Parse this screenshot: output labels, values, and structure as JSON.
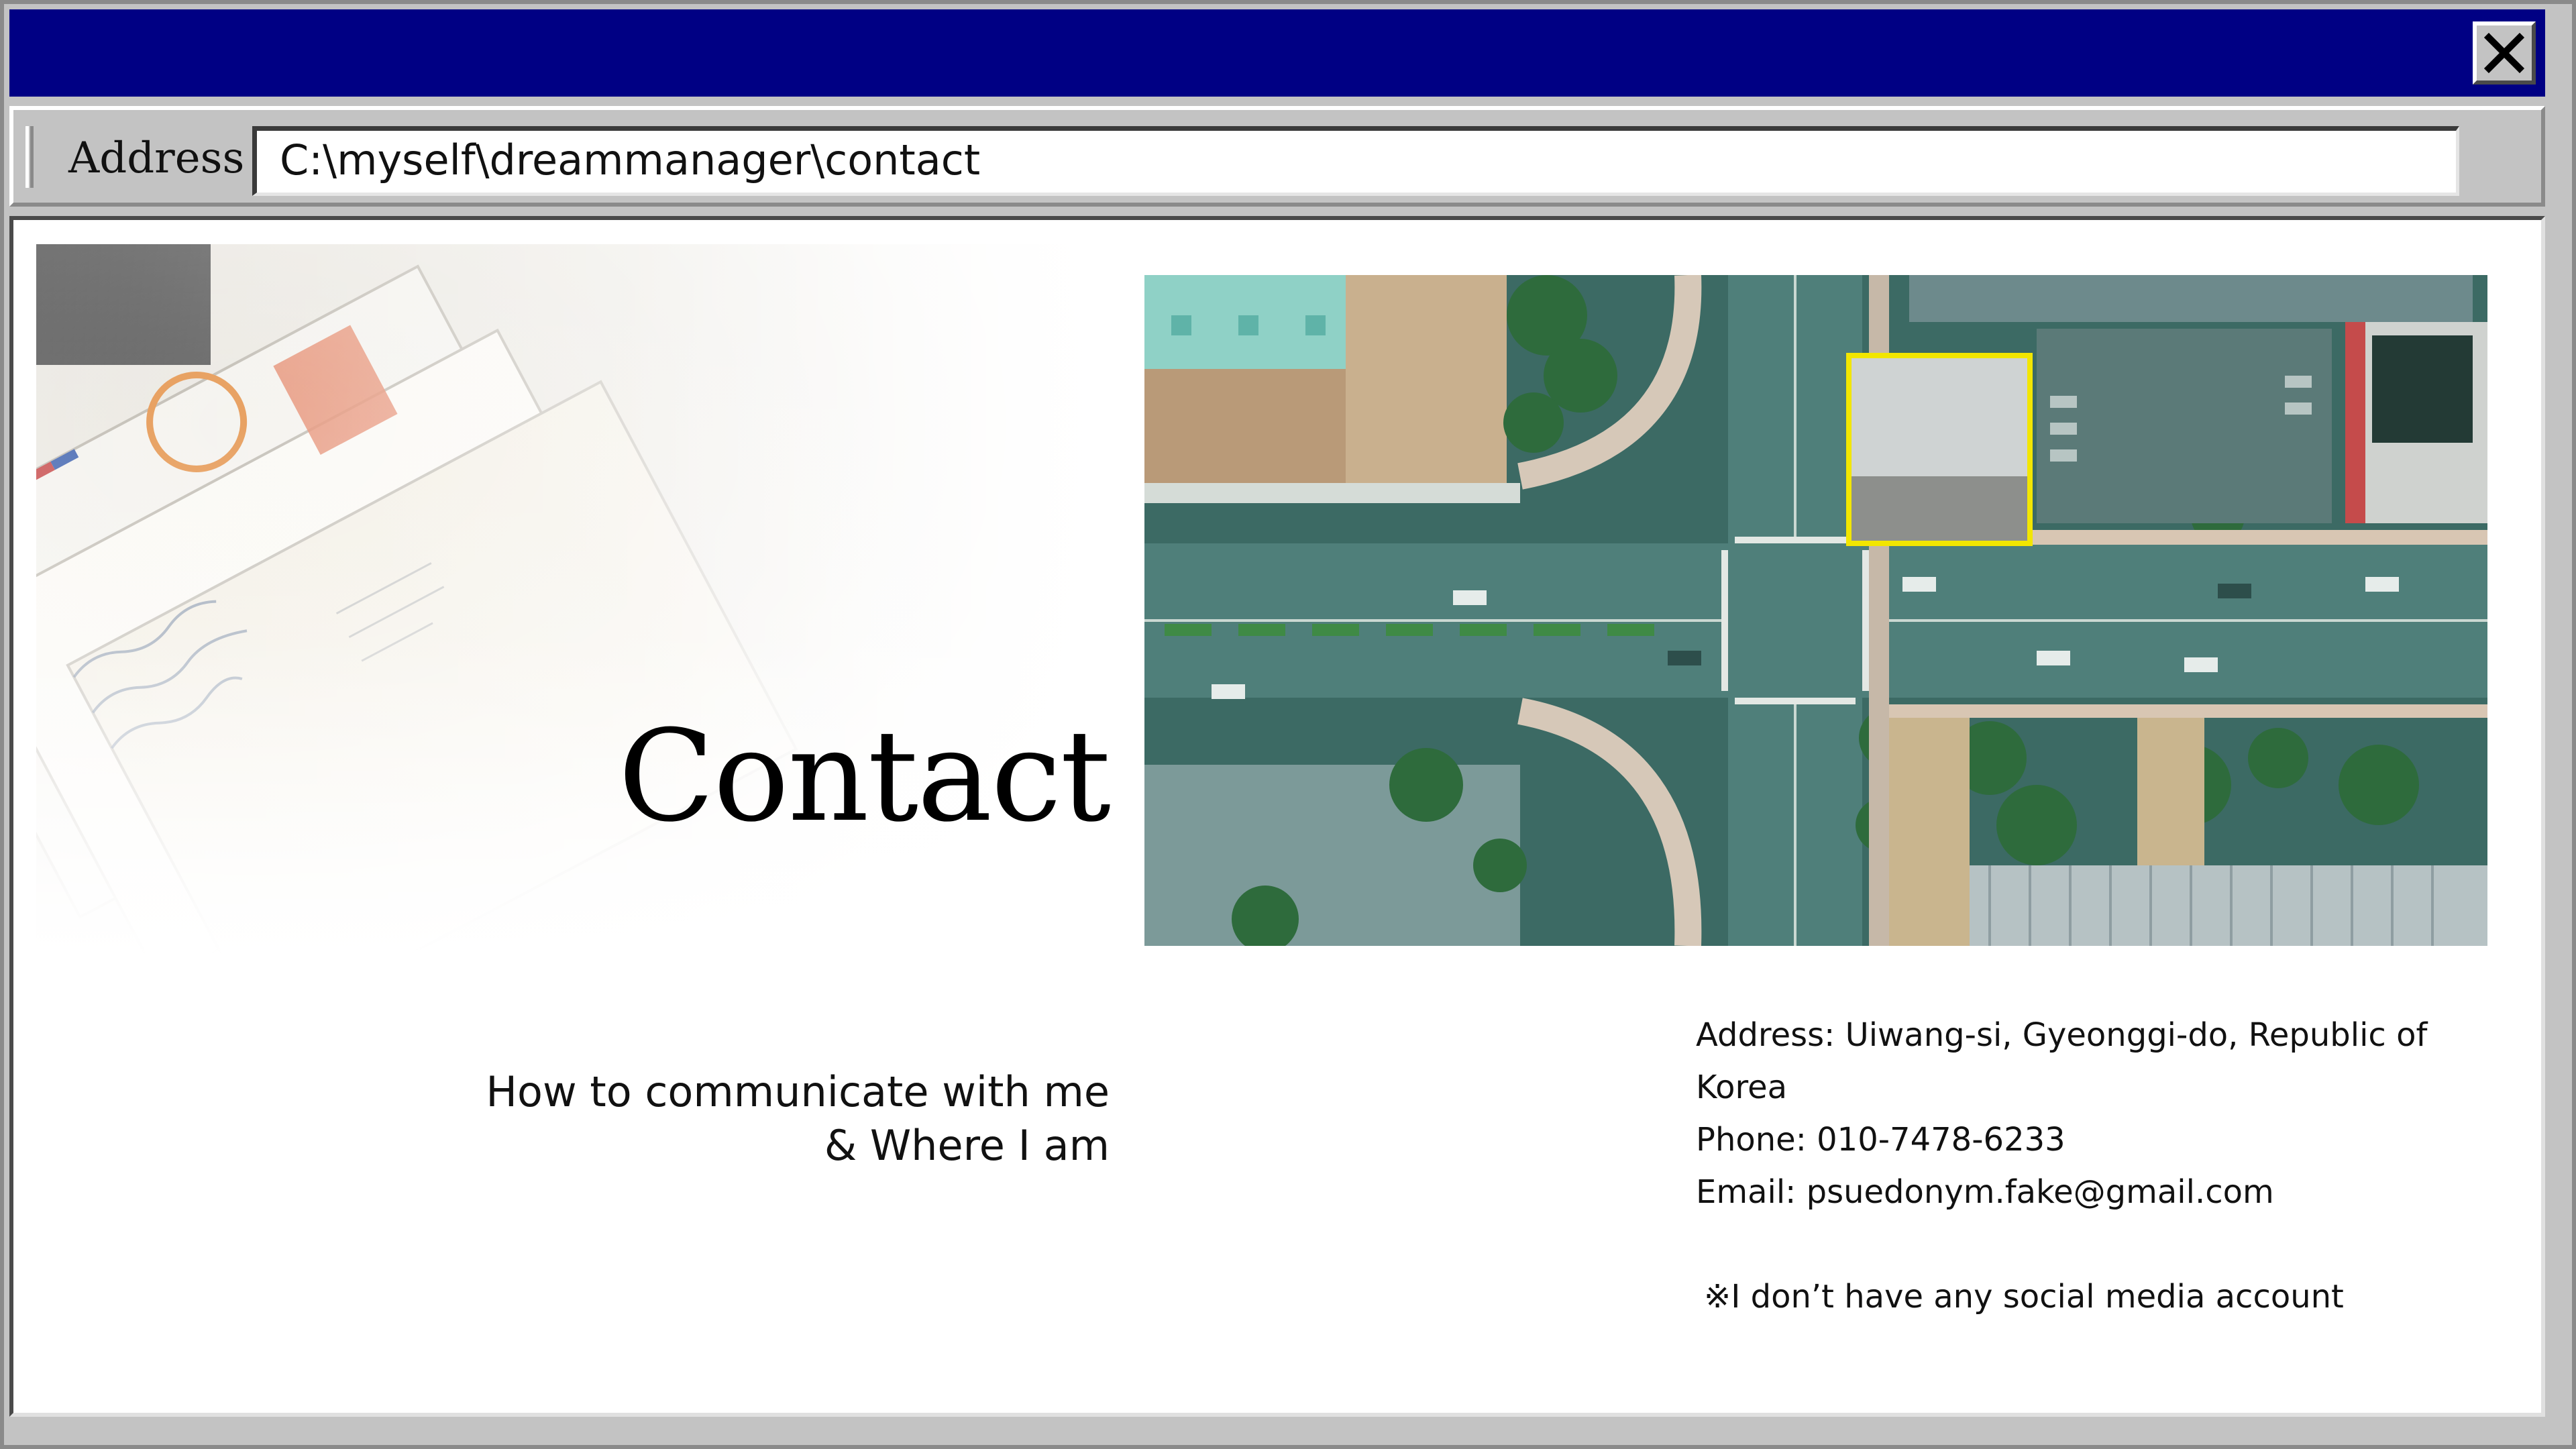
{
  "window": {
    "address_label": "Address",
    "address_value": "C:\\myself\\dreammanager\\contact"
  },
  "hero": {
    "heading": "Contact",
    "subtitle_line1": "How to communicate with me",
    "subtitle_line2": "& Where I am"
  },
  "contact": {
    "address": "Address: Uiwang-si, Gyeonggi-do, Republic of Korea",
    "phone": "Phone: 010-7478-6233",
    "email": "Email: psuedonym.fake@gmail.com",
    "note": "※I don’t have any social media account"
  },
  "images": {
    "left": "airmail-letters-photo",
    "right": "aerial-intersection-photo"
  },
  "colors": {
    "titlebar": "#000084",
    "chrome": "#c3c3c3",
    "highlight_box": "#f2e600"
  }
}
